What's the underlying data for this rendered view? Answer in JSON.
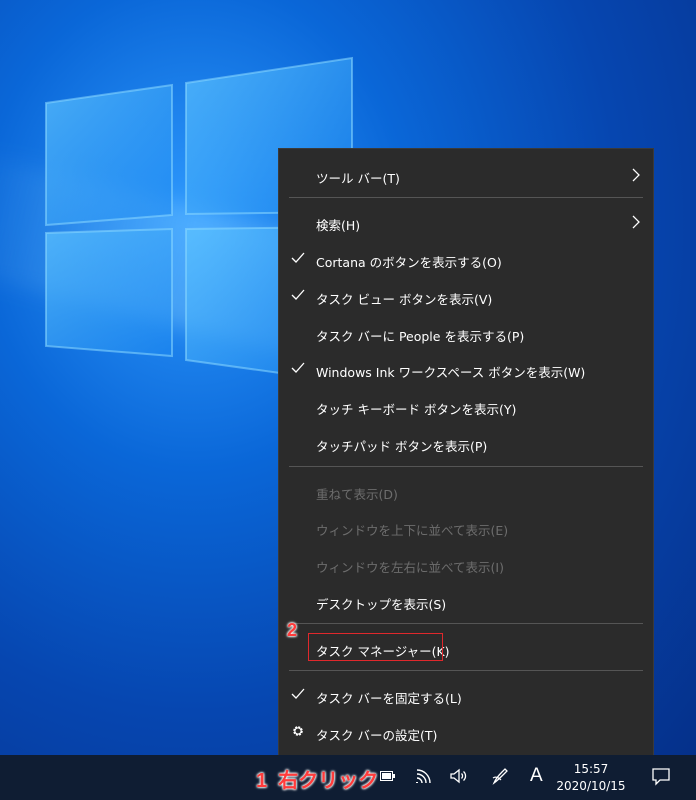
{
  "context_menu": {
    "items": [
      {
        "label": "ツール バー(T)"
      },
      {
        "label": "検索(H)"
      },
      {
        "label": "Cortana のボタンを表示する(O)"
      },
      {
        "label": "タスク ビュー ボタンを表示(V)"
      },
      {
        "label": "タスク バーに People を表示する(P)"
      },
      {
        "label": "Windows Ink ワークスペース ボタンを表示(W)"
      },
      {
        "label": "タッチ キーボード ボタンを表示(Y)"
      },
      {
        "label": "タッチパッド ボタンを表示(P)"
      },
      {
        "label": "重ねて表示(D)"
      },
      {
        "label": "ウィンドウを上下に並べて表示(E)"
      },
      {
        "label": "ウィンドウを左右に並べて表示(I)"
      },
      {
        "label": "デスクトップを表示(S)"
      },
      {
        "label": "タスク マネージャー(K)"
      },
      {
        "label": "タスク バーを固定する(L)"
      },
      {
        "label": "タスク バーの設定(T)"
      }
    ]
  },
  "annotations": {
    "step1_number": "1",
    "step1_text": "右クリック",
    "step2_number": "2"
  },
  "taskbar": {
    "ime_mode": "A",
    "time": "15:57",
    "date": "2020/10/15"
  },
  "colors": {
    "menu_bg": "#2b2b2b",
    "highlight_border": "#e0282c",
    "annotation_red": "#ff3b3b",
    "taskbar_bg": "#0f1d33"
  }
}
